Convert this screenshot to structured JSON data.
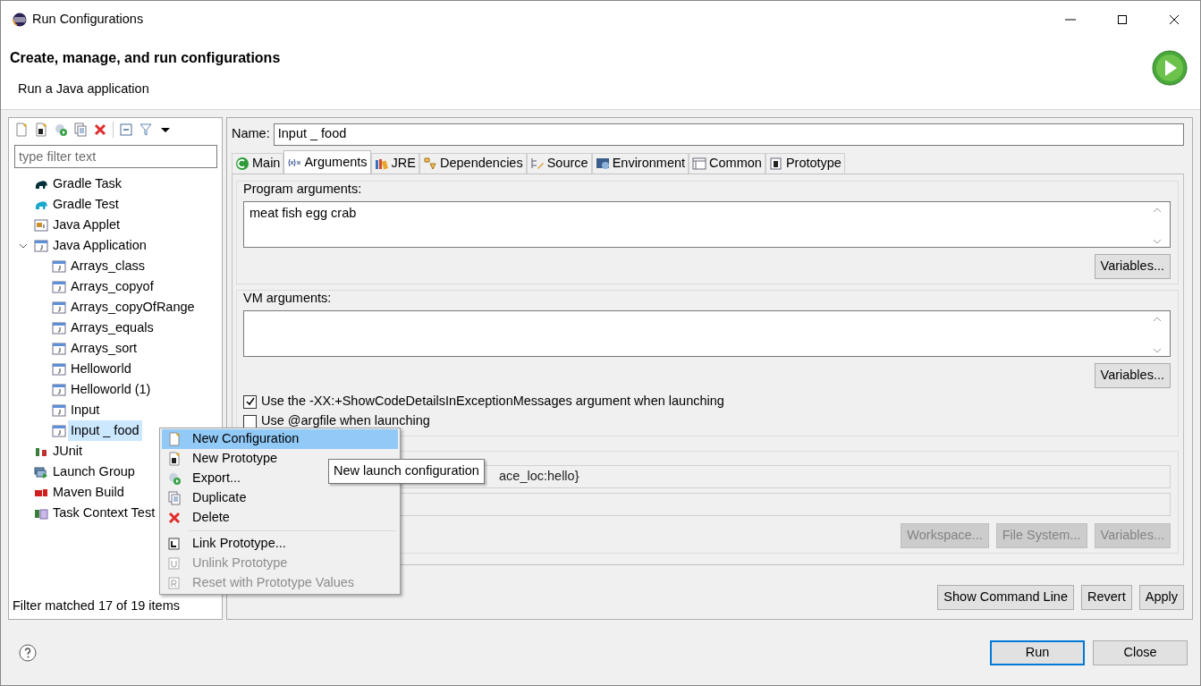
{
  "window": {
    "title": "Run Configurations"
  },
  "header": {
    "title": "Create, manage, and run configurations",
    "subtitle": "Run a Java application"
  },
  "sidebar": {
    "filter": {
      "placeholder": "type filter text"
    },
    "tree": [
      {
        "label": "Gradle Task",
        "kind": "gradle-task",
        "selected": false
      },
      {
        "label": "Gradle Test",
        "kind": "gradle-test",
        "selected": false
      },
      {
        "label": "Java Applet",
        "kind": "applet",
        "selected": false
      },
      {
        "label": "Java Application",
        "kind": "java",
        "selected": false,
        "expanded": true,
        "children": [
          {
            "label": "Arrays_class",
            "kind": "java",
            "selected": false
          },
          {
            "label": "Arrays_copyof",
            "kind": "java",
            "selected": false
          },
          {
            "label": "Arrays_copyOfRange",
            "kind": "java",
            "selected": false
          },
          {
            "label": "Arrays_equals",
            "kind": "java",
            "selected": false
          },
          {
            "label": "Arrays_sort",
            "kind": "java",
            "selected": false
          },
          {
            "label": "Helloworld",
            "kind": "java",
            "selected": false
          },
          {
            "label": "Helloworld (1)",
            "kind": "java",
            "selected": false
          },
          {
            "label": "Input",
            "kind": "java",
            "selected": false
          },
          {
            "label": "Input _ food",
            "kind": "java",
            "selected": true
          }
        ]
      },
      {
        "label": "JUnit",
        "kind": "junit",
        "selected": false
      },
      {
        "label": "Launch Group",
        "kind": "launch-group",
        "selected": false
      },
      {
        "label": "Maven Build",
        "kind": "maven",
        "selected": false
      },
      {
        "label": "Task Context Test",
        "kind": "task-test",
        "selected": false
      }
    ],
    "status": "Filter matched 17 of 19 items"
  },
  "name_field": {
    "label": "Name:",
    "value": "Input _ food"
  },
  "tabs": [
    {
      "label": "Main",
      "kind": "main",
      "selected": false
    },
    {
      "label": "Arguments",
      "kind": "arguments",
      "selected": true
    },
    {
      "label": "JRE",
      "kind": "jre",
      "selected": false
    },
    {
      "label": "Dependencies",
      "kind": "dependencies",
      "selected": false
    },
    {
      "label": "Source",
      "kind": "source",
      "selected": false
    },
    {
      "label": "Environment",
      "kind": "environment",
      "selected": false
    },
    {
      "label": "Common",
      "kind": "common",
      "selected": false
    },
    {
      "label": "Prototype",
      "kind": "prototype",
      "selected": false
    }
  ],
  "program_arguments": {
    "label": "Program arguments:",
    "value": "meat fish egg crab",
    "button": "Variables..."
  },
  "vm_arguments": {
    "label": "VM arguments:",
    "button": "Variables..."
  },
  "options": [
    {
      "label": "Use the -XX:+ShowCodeDetailsInExceptionMessages argument when launching",
      "checked": true
    },
    {
      "label": "Use @argfile when launching",
      "checked": false
    }
  ],
  "working_directory": {
    "value": "ace_loc:hello}",
    "buttons": [
      {
        "label": "Workspace...",
        "disabled": true
      },
      {
        "label": "File System...",
        "disabled": true
      },
      {
        "label": "Variables...",
        "disabled": true
      }
    ]
  },
  "actions": [
    {
      "label": "Show Command Line",
      "focused": false
    },
    {
      "label": "Revert",
      "focused": false
    },
    {
      "label": "Apply",
      "focused": false
    }
  ],
  "footer_buttons": [
    {
      "label": "Run",
      "focused": true
    },
    {
      "label": "Close",
      "focused": false
    }
  ],
  "context_menu": {
    "items": [
      {
        "kind": "new-config",
        "label": "New Configuration",
        "disabled": false,
        "selected": true
      },
      {
        "kind": "new-prototype",
        "label": "New Prototype",
        "disabled": false,
        "selected": false
      },
      {
        "kind": "export",
        "label": "Export...",
        "disabled": false,
        "selected": false
      },
      {
        "kind": "duplicate",
        "label": "Duplicate",
        "disabled": false,
        "selected": false
      },
      {
        "kind": "delete",
        "label": "Delete",
        "disabled": false,
        "selected": false
      },
      {
        "kind": "separator"
      },
      {
        "kind": "link",
        "label": "Link Prototype...",
        "disabled": false,
        "selected": false
      },
      {
        "kind": "unlink",
        "label": "Unlink Prototype",
        "disabled": true,
        "selected": false
      },
      {
        "kind": "reset",
        "label": "Reset with Prototype Values",
        "disabled": true,
        "selected": false
      }
    ]
  },
  "tooltip": "New launch configuration"
}
